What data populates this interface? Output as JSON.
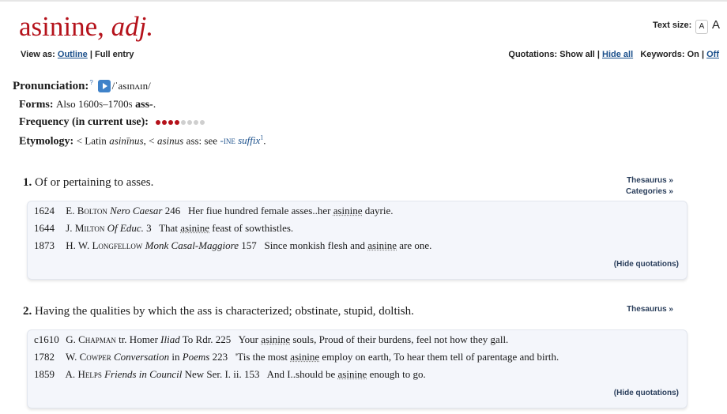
{
  "entry": {
    "headword": "asinine",
    "sep": ", ",
    "pos": "adj.",
    "text_size_label": "Text size:",
    "text_size_small": "A",
    "text_size_large": "A"
  },
  "view": {
    "label": "View as:",
    "outline": "Outline",
    "sep": "|",
    "full": "Full entry"
  },
  "options": {
    "quotations_label": "Quotations:",
    "show_all": "Show all",
    "sep1": "|",
    "hide_all": "Hide all",
    "keywords_label": "Keywords:",
    "on": "On",
    "sep2": "|",
    "off": "Off"
  },
  "pronunciation": {
    "label": "Pronunciation:",
    "help": "?",
    "ipa": "/ˈasɪnʌɪn/"
  },
  "forms": {
    "label": "Forms:",
    "also": "Also",
    "period": "1600s–1700s",
    "variant": "ass-",
    "end": "."
  },
  "frequency": {
    "label": "Frequency (in current use):",
    "filled": 4,
    "total": 8,
    "filled_color": "#b5121b",
    "empty_color": "#cfcfcf"
  },
  "etymology": {
    "label": "Etymology:",
    "lt1": "< Latin",
    "w1": "asinīnus",
    "lt2": ", <",
    "w2": "asinus",
    "ass_see": "ass: see",
    "link_caps": "-ine",
    "link_word": "suffix",
    "link_sup": "1",
    "end": "."
  },
  "senses": [
    {
      "number": "1.",
      "definition": "Of or pertaining to asses.",
      "thesaurus": "Thesaurus »",
      "categories": "Categories »",
      "hide": "(Hide quotations)",
      "quotes": [
        {
          "year": "1624",
          "author_first": "E.",
          "author_last": "Bolton",
          "work": "Nero Caesar",
          "ref": "246",
          "pre": "Her fiue hundred female asses..her",
          "kw": "asinine",
          "post": "dayrie."
        },
        {
          "year": "1644",
          "author_first": "J.",
          "author_last": "Milton",
          "work": "Of Educ.",
          "ref": "3",
          "pre": "That",
          "kw": "asinine",
          "post": "feast of sowthistles."
        },
        {
          "year": "1873",
          "author_first": "H. W.",
          "author_last": "Longfellow",
          "work": "Monk Casal-Maggiore",
          "ref": "157",
          "pre": "Since monkish flesh and",
          "kw": "asinine",
          "post": "are one."
        }
      ]
    },
    {
      "number": "2.",
      "definition": "Having the qualities by which the ass is characterized; obstinate, stupid, doltish.",
      "thesaurus": "Thesaurus »",
      "hide": "(Hide quotations)",
      "quotes": [
        {
          "year": "c1610",
          "author_first": "G.",
          "author_last": "Chapman",
          "mid": "tr. Homer",
          "work": "Iliad",
          "ref": "To Rdr. 225",
          "pre": "Your",
          "kw": "asinine",
          "post": "souls, Proud of their burdens, feel not how they gall."
        },
        {
          "year": "1782",
          "author_first": "W.",
          "author_last": "Cowper",
          "work": "Conversation",
          "mid2": "in",
          "work2": "Poems",
          "ref": "223",
          "pre": "'Tis the most",
          "kw": "asinine",
          "post": "employ on earth, To hear them tell of parentage and birth."
        },
        {
          "year": "1859",
          "author_first": "A.",
          "author_last": "Helps",
          "work": "Friends in Council",
          "ref": "New Ser. I. ii. 153",
          "pre": "And I..should be",
          "kw": "asinine",
          "post": "enough to go."
        }
      ]
    }
  ]
}
